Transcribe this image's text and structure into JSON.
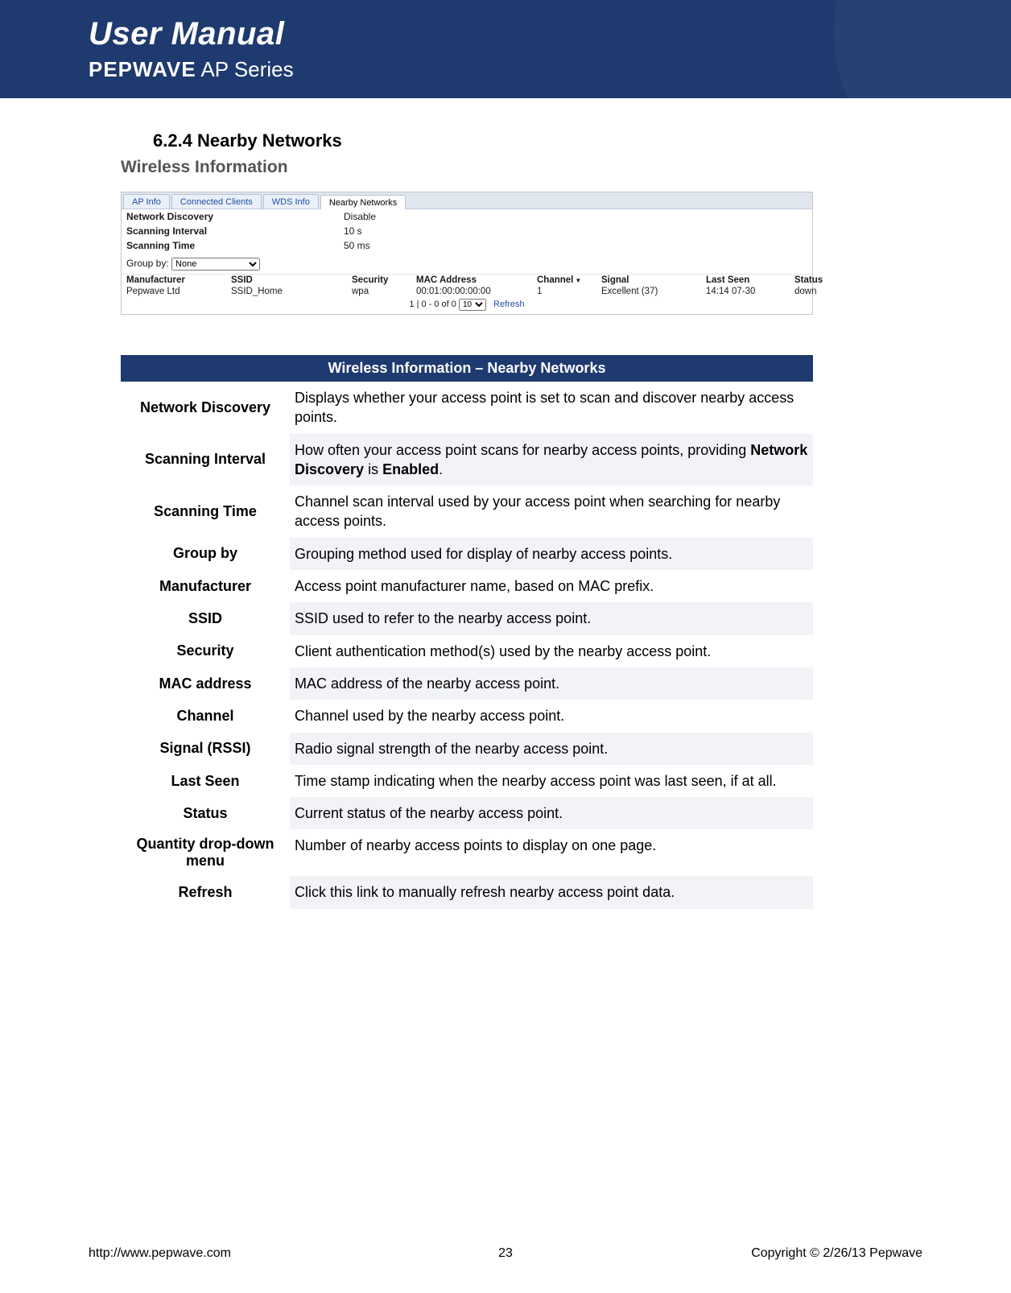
{
  "banner": {
    "title": "User Manual",
    "brand": "PEPWAVE",
    "series": " AP Series"
  },
  "section": {
    "number": "6.2.4",
    "title": "Nearby Networks",
    "heading_full": "6.2.4 Nearby Networks",
    "wireless_info": "Wireless Information"
  },
  "shot": {
    "tabs": [
      "AP Info",
      "Connected Clients",
      "WDS Info",
      "Nearby Networks"
    ],
    "active_tab": 3,
    "kv": [
      {
        "k": "Network Discovery",
        "v": "Disable"
      },
      {
        "k": "Scanning Interval",
        "v": "10 s"
      },
      {
        "k": "Scanning Time",
        "v": "50 ms"
      }
    ],
    "groupby_label": "Group by:",
    "groupby_value": "None",
    "columns": [
      "Manufacturer",
      "SSID",
      "Security",
      "MAC Address",
      "Channel",
      "Signal",
      "Last Seen",
      "Status"
    ],
    "sort_col": "Channel",
    "rows": [
      {
        "Manufacturer": "Pepwave Ltd",
        "SSID": "SSID_Home",
        "Security": "wpa",
        "MAC Address": "00:01:00:00:00:00",
        "Channel": "1",
        "Signal": "Excellent (37)",
        "Last Seen": "14:14 07-30",
        "Status": "down"
      }
    ],
    "pager": {
      "text_left": "1  |  0 - 0 of 0",
      "qty": "10",
      "refresh": "Refresh"
    }
  },
  "desc": {
    "title": "Wireless Information – Nearby Networks",
    "rows": [
      {
        "label": "Network Discovery",
        "text": "Displays whether your access point is set to scan and discover nearby access points."
      },
      {
        "label": "Scanning Interval",
        "text_pre": "How often your access point scans for nearby access points, providing ",
        "kw1": "Network Discovery",
        "mid": " is ",
        "kw2": "Enabled",
        "text_post": "."
      },
      {
        "label": "Scanning Time",
        "text": "Channel scan interval used by your access point when searching for nearby access points."
      },
      {
        "label": "Group by",
        "text": "Grouping method used for display of nearby access points."
      },
      {
        "label": "Manufacturer",
        "text": "Access point manufacturer name, based on MAC prefix."
      },
      {
        "label": "SSID",
        "text": "SSID used to refer to the nearby access point."
      },
      {
        "label": "Security",
        "text": "Client authentication method(s) used by the nearby access point."
      },
      {
        "label": "MAC address",
        "text": "MAC address of the nearby access point."
      },
      {
        "label": "Channel",
        "text": "Channel used by the nearby access point."
      },
      {
        "label": "Signal (RSSI)",
        "text": "Radio signal strength of the nearby access point."
      },
      {
        "label": "Last Seen",
        "text": "Time stamp indicating when the nearby access point was last seen, if at all."
      },
      {
        "label": "Status",
        "text": "Current status of the nearby access point."
      },
      {
        "label": "Quantity drop-down menu",
        "text": "Number of nearby access points to display on one page."
      },
      {
        "label": "Refresh",
        "text": "Click this link to manually refresh nearby access point data."
      }
    ]
  },
  "footer": {
    "url": "http://www.pepwave.com",
    "page": "23",
    "copyright": "Copyright © 2/26/13 Pepwave"
  }
}
